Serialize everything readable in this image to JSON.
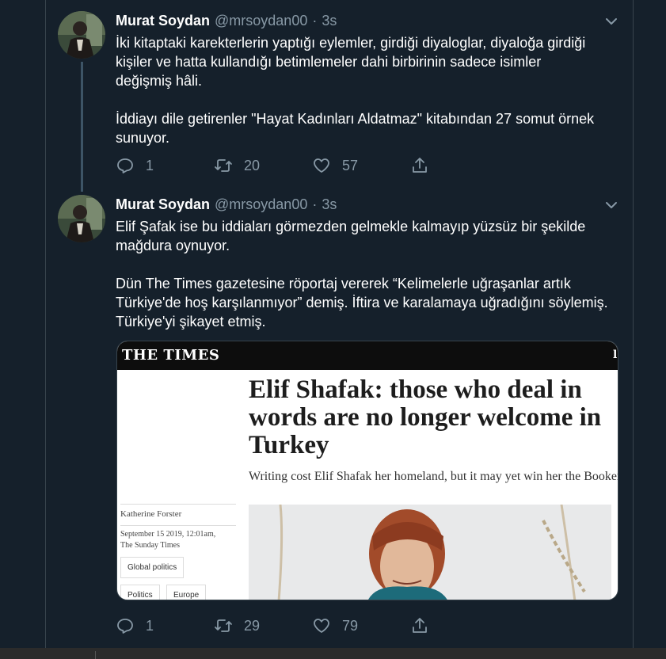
{
  "tweets": [
    {
      "name": "Murat Soydan",
      "handle": "@mrsoydan00",
      "separator": "·",
      "time": "3s",
      "paragraphs": [
        "İki kitaptaki karekterlerin yaptığı eylemler, girdiği diyaloglar, diyaloğa girdiği\nkişiler ve hatta kullandığı betimlemeler dahi birbirinin sadece isimler\ndeğişmiş hâli.",
        "İddiayı dile getirenler \"Hayat Kadınları Aldatmaz\" kitabından 27 somut örnek\nsunuyor."
      ],
      "replies": "1",
      "retweets": "20",
      "likes": "57"
    },
    {
      "name": "Murat Soydan",
      "handle": "@mrsoydan00",
      "separator": "·",
      "time": "3s",
      "paragraphs": [
        "Elif Şafak ise bu iddiaları görmezden gelmekle kalmayıp yüzsüz bir şekilde\nmağdura oynuyor.",
        "Dün The Times gazetesine röportaj vererek “Kelimelerle uğraşanlar artık\nTürkiye'de hoş karşılanmıyor” demiş. İftira ve karalamaya uğradığını söylemiş.\nTürkiye'yi şikayet etmiş."
      ],
      "replies": "1",
      "retweets": "29",
      "likes": "79"
    }
  ],
  "card": {
    "logo": "THE TIMES",
    "logo_cut": "l",
    "headline": "Elif Shafak: those who deal in words are no longer welcome in Turkey",
    "standfirst": "Writing cost Elif Shafak her homeland, but it may yet win her the Booker",
    "author": "Katherine Forster",
    "date": "September 15 2019, 12:01am,\nThe Sunday Times",
    "tags": [
      "Global politics",
      "Politics",
      "Europe"
    ]
  },
  "icons": [
    "reply-icon",
    "retweet-icon",
    "like-icon",
    "share-icon",
    "caret-down-icon"
  ],
  "colors": {
    "background": "#15202b",
    "border": "#38444d",
    "muted_text": "#8899a6",
    "thread_line": "#3d5466"
  }
}
